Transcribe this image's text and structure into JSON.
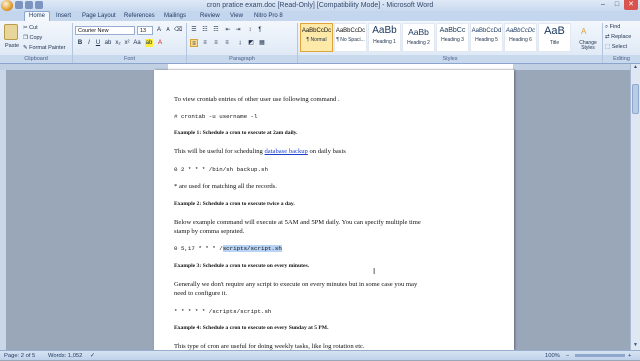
{
  "window": {
    "title": "cron pratice exam.doc [Read-Only] [Compatibility Mode] - Microsoft Word",
    "min": "–",
    "max": "□",
    "close": "✕"
  },
  "tabs": [
    "Home",
    "Insert",
    "Page Layout",
    "References",
    "Mailings",
    "Review",
    "View",
    "Nitro Pro 8"
  ],
  "clipboard": {
    "paste": "Paste",
    "cut": "Cut",
    "copy": "Copy",
    "format_painter": "Format Painter",
    "label": "Clipboard"
  },
  "font": {
    "name": "Courier New",
    "size": "13",
    "label": "Font"
  },
  "paragraph": {
    "label": "Paragraph"
  },
  "styles": {
    "label": "Styles",
    "items": [
      {
        "sample": "AaBbCcDc",
        "name": "¶ Normal"
      },
      {
        "sample": "AaBbCcDc",
        "name": "¶ No Spaci..."
      },
      {
        "sample": "AaBb",
        "name": "Heading 1"
      },
      {
        "sample": "AaBb",
        "name": "Heading 2"
      },
      {
        "sample": "AaBbCc",
        "name": "Heading 3"
      },
      {
        "sample": "AaBbCcDd",
        "name": "Heading 5"
      },
      {
        "sample": "AaBbCcDc",
        "name": "Heading 6"
      },
      {
        "sample": "AaB",
        "name": "Title"
      }
    ],
    "change": "Change Styles"
  },
  "editing": {
    "find": "Find",
    "replace": "Replace",
    "select": "Select",
    "label": "Editing"
  },
  "document": {
    "p1": "To view crontab entries of other user use following command .",
    "code1": "# crontab -u username -l",
    "ex1": "Example 1: Schedule a cron to execute at 2am daily.",
    "p2_pre": "This will be useful for scheduling ",
    "p2_link": "database backup",
    "p2_post": " on daily basis",
    "code2": "0 2 * * * /bin/sh backup.sh",
    "p3": "* are used for matching all the records.",
    "ex2": "Example 2: Schedule a cron to execute twice a day.",
    "p4a": "Below example command will execute at 5AM and 5PM daily. You can specify multiple time",
    "p4b": "stamp by comma seprated.",
    "code3_pre": "0 5,17 * * * /",
    "code3_hl": "scripts/script.sh",
    "ex3": "Example 3: Schedule a cron to execute on every minutes.",
    "p5a": "Generally we don't require any script to execute on every minutes but in some case you may",
    "p5b": "need to configure it.",
    "code4": "* * * * *  /scripts/script.sh",
    "ex4": "Example 4: Schedule a cron to execute on every Sunday at 5 PM.",
    "p6": "This type of cron are useful for doing weekly tasks, like log rotation etc."
  },
  "status": {
    "page": "Page: 2 of 5",
    "words": "Words: 1,052",
    "zoom": "100%"
  }
}
